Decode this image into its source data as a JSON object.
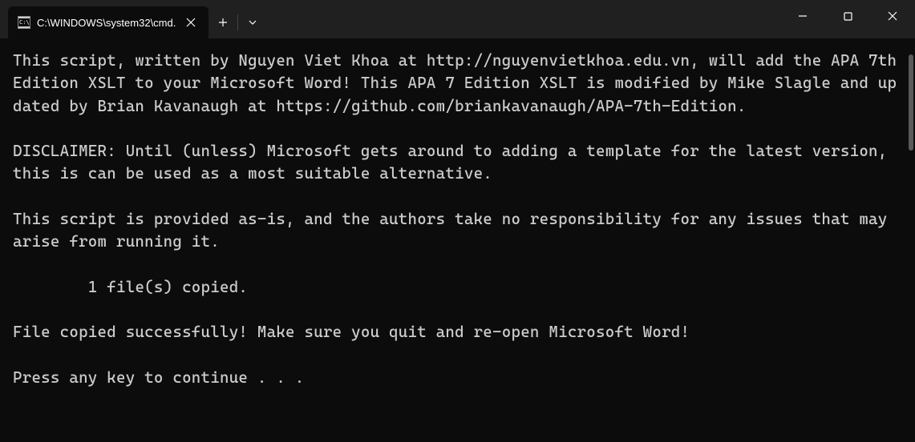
{
  "titlebar": {
    "tab_title": "C:\\WINDOWS\\system32\\cmd.",
    "tab_icon_label": "cmd"
  },
  "terminal": {
    "lines": [
      "This script, written by Nguyen Viet Khoa at http://nguyenvietkhoa.edu.vn, will add the APA 7th Edition XSLT to your Microsoft Word! This APA 7 Edition XSLT is modified by Mike Slagle and updated by Brian Kavanaugh at https://github.com/briankavanaugh/APA-7th-Edition.",
      "",
      "DISCLAIMER: Until (unless) Microsoft gets around to adding a template for the latest version, this is can be used as a most suitable alternative.",
      "",
      "This script is provided as-is, and the authors take no responsibility for any issues that may arise from running it.",
      "",
      "        1 file(s) copied.",
      "",
      "File copied successfully! Make sure you quit and re-open Microsoft Word!",
      "",
      "Press any key to continue . . ."
    ]
  }
}
